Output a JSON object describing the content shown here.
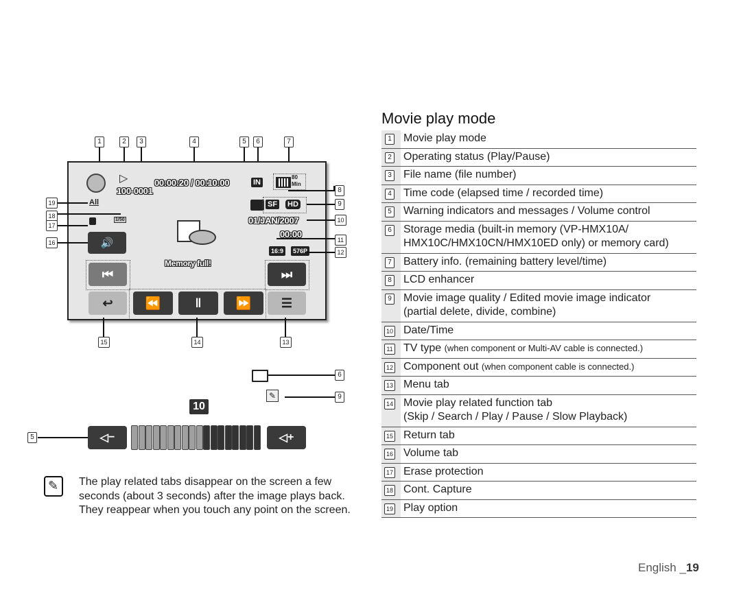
{
  "section": {
    "title": "Movie play mode"
  },
  "lcd": {
    "file_name": "100-0001",
    "time_code": "00:00:20 / 00:10:00",
    "storage": "IN",
    "battery_time_value": "80",
    "battery_time_unit": "Min",
    "quality": "SF",
    "resolution": "HD",
    "date": "01/JAN/2007",
    "time": "00:00",
    "tv_type": "16:9",
    "component_out": "576P",
    "play_option": "All",
    "cont_capture": "1/50",
    "message": "Memory full!",
    "icons": {
      "movie_mode": "film-reel-icon",
      "status": "play-icon",
      "lcd_enhancer": "lcd-enhancer-icon",
      "erase_protection": "lock-icon",
      "warning": "internal-memory-full-icon"
    },
    "buttons": {
      "volume": "🔊",
      "skip_back": "⏮",
      "skip_forward": "⏭",
      "return": "↩",
      "rewind": "⏪",
      "pause": "‖",
      "fast_forward": "⏩",
      "menu": "☰"
    }
  },
  "callouts": {
    "top": [
      "1",
      "2",
      "3",
      "4",
      "5",
      "6",
      "7"
    ],
    "right": [
      "8",
      "9",
      "10",
      "11",
      "12"
    ],
    "left": [
      "19",
      "18",
      "17",
      "16"
    ],
    "bottom": [
      "15",
      "14",
      "13"
    ],
    "extra": [
      "6",
      "9",
      "5"
    ]
  },
  "volume": {
    "level_label": "10",
    "level": 10,
    "max": 18,
    "minus_label": "−",
    "plus_label": "+"
  },
  "items": [
    {
      "num": "1",
      "text": "Movie play mode"
    },
    {
      "num": "2",
      "text": "Operating status (Play/Pause)"
    },
    {
      "num": "3",
      "text": "File name (file number)"
    },
    {
      "num": "4",
      "text": "Time code (elapsed time / recorded time)"
    },
    {
      "num": "5",
      "text": "Warning indicators and messages / Volume control"
    },
    {
      "num": "6",
      "text": "Storage media (built-in memory (VP-HMX10A/",
      "text2": "HMX10C/HMX10CN/HMX10ED only) or memory card)"
    },
    {
      "num": "7",
      "text": "Battery info. (remaining battery level/time)"
    },
    {
      "num": "8",
      "text": "LCD enhancer"
    },
    {
      "num": "9",
      "text": "Movie image quality / Edited movie image indicator",
      "text2": "(partial delete, divide, combine)"
    },
    {
      "num": "10",
      "text": "Date/Time"
    },
    {
      "num": "11",
      "text": "TV type ",
      "small": "(when component or Multi-AV cable is connected.)"
    },
    {
      "num": "12",
      "text": "Component out ",
      "small": "(when component cable is connected.)"
    },
    {
      "num": "13",
      "text": "Menu tab"
    },
    {
      "num": "14",
      "text": "Movie play related function tab",
      "text2": "(Skip / Search / Play / Pause / Slow Playback)"
    },
    {
      "num": "15",
      "text": "Return tab"
    },
    {
      "num": "16",
      "text": "Volume tab"
    },
    {
      "num": "17",
      "text": "Erase protection"
    },
    {
      "num": "18",
      "text": "Cont. Capture"
    },
    {
      "num": "19",
      "text": "Play option"
    }
  ],
  "note": {
    "icon": "note-pencil-icon",
    "text": "The play related tabs disappear on the screen a few seconds (about 3 seconds) after the image plays back. They reappear when you touch any point on the screen."
  },
  "footer": {
    "language": "English _",
    "page": "19"
  }
}
